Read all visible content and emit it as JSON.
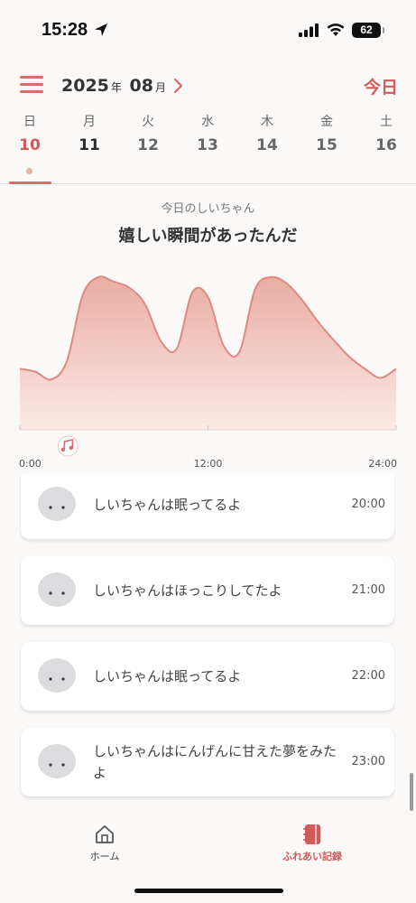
{
  "status_bar": {
    "time": "15:28",
    "battery": "62"
  },
  "header": {
    "year": "2025",
    "year_unit": "年",
    "month": "08",
    "month_unit": "月",
    "today_label": "今日"
  },
  "week": [
    {
      "dow": "日",
      "num": "10"
    },
    {
      "dow": "月",
      "num": "11"
    },
    {
      "dow": "火",
      "num": "12"
    },
    {
      "dow": "水",
      "num": "13"
    },
    {
      "dow": "木",
      "num": "14"
    },
    {
      "dow": "金",
      "num": "15"
    },
    {
      "dow": "土",
      "num": "16"
    }
  ],
  "mood": {
    "subtitle": "今日のしいちゃん",
    "title": "嬉しい瞬間があったんだ"
  },
  "chart_data": {
    "type": "area",
    "x": [
      0,
      1,
      2,
      3,
      4,
      5,
      6,
      7,
      8,
      9,
      10,
      11,
      12,
      13,
      14,
      15,
      16,
      17,
      18,
      19,
      20,
      21,
      22,
      23,
      24
    ],
    "values": [
      0.4,
      0.38,
      0.33,
      0.45,
      0.88,
      1.0,
      0.97,
      0.93,
      0.82,
      0.58,
      0.53,
      0.9,
      0.87,
      0.55,
      0.51,
      0.92,
      1.0,
      0.96,
      0.85,
      0.71,
      0.59,
      0.48,
      0.4,
      0.34,
      0.4
    ],
    "xlim": [
      0,
      24
    ],
    "ylim": [
      0,
      1.1
    ],
    "x_ticks": [
      "0:00",
      "12:00",
      "24:00"
    ],
    "markers": [
      {
        "x": 1.0,
        "icon": "music-note-icon"
      }
    ],
    "colors": {
      "line": "#df8a80",
      "fill_top": "#e9aca3",
      "fill_bottom": "#fbeae6"
    }
  },
  "records": [
    {
      "message": "しいちゃんは眠ってるよ",
      "time": "20:00"
    },
    {
      "message": "しいちゃんはほっこりしてたよ",
      "time": "21:00"
    },
    {
      "message": "しいちゃんは眠ってるよ",
      "time": "22:00"
    },
    {
      "message": "しいちゃんはにんげんに甘えた夢をみたよ",
      "time": "23:00"
    }
  ],
  "tabs": {
    "home": "ホーム",
    "records": "ふれあい記録"
  },
  "colors": {
    "accent": "#d05a5a",
    "background": "#fbf9f8"
  }
}
